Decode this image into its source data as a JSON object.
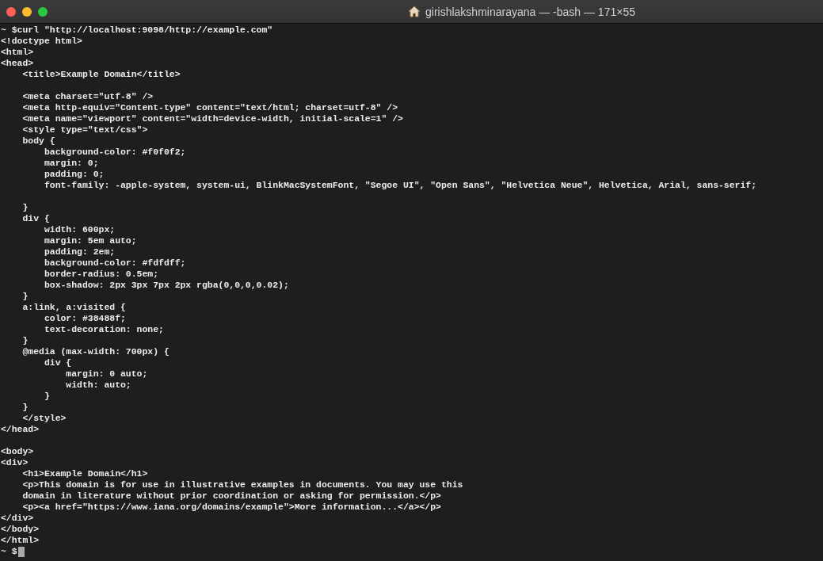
{
  "window": {
    "title": "girishlakshminarayana — -bash — 171×55"
  },
  "terminal": {
    "blocks": [
      [
        "~ $curl \"http://localhost:9098/http://example.com\"",
        "<!doctype html>",
        "<html>",
        "<head>",
        "    <title>Example Domain</title>"
      ],
      [
        "    <meta charset=\"utf-8\" />",
        "    <meta http-equiv=\"Content-type\" content=\"text/html; charset=utf-8\" />",
        "    <meta name=\"viewport\" content=\"width=device-width, initial-scale=1\" />",
        "    <style type=\"text/css\">",
        "    body {",
        "        background-color: #f0f0f2;",
        "        margin: 0;",
        "        padding: 0;",
        "        font-family: -apple-system, system-ui, BlinkMacSystemFont, \"Segoe UI\", \"Open Sans\", \"Helvetica Neue\", Helvetica, Arial, sans-serif;"
      ],
      [
        "    }",
        "    div {",
        "        width: 600px;",
        "        margin: 5em auto;",
        "        padding: 2em;",
        "        background-color: #fdfdff;",
        "        border-radius: 0.5em;",
        "        box-shadow: 2px 3px 7px 2px rgba(0,0,0,0.02);",
        "    }",
        "    a:link, a:visited {",
        "        color: #38488f;",
        "        text-decoration: none;",
        "    }",
        "    @media (max-width: 700px) {",
        "        div {",
        "            margin: 0 auto;",
        "            width: auto;",
        "        }",
        "    }",
        "    </style>",
        "</head>"
      ],
      [
        "<body>",
        "<div>",
        "    <h1>Example Domain</h1>",
        "    <p>This domain is for use in illustrative examples in documents. You may use this",
        "    domain in literature without prior coordination or asking for permission.</p>",
        "    <p><a href=\"https://www.iana.org/domains/example\">More information...</a></p>",
        "</div>",
        "</body>",
        "</html>",
        "~ $"
      ]
    ]
  }
}
